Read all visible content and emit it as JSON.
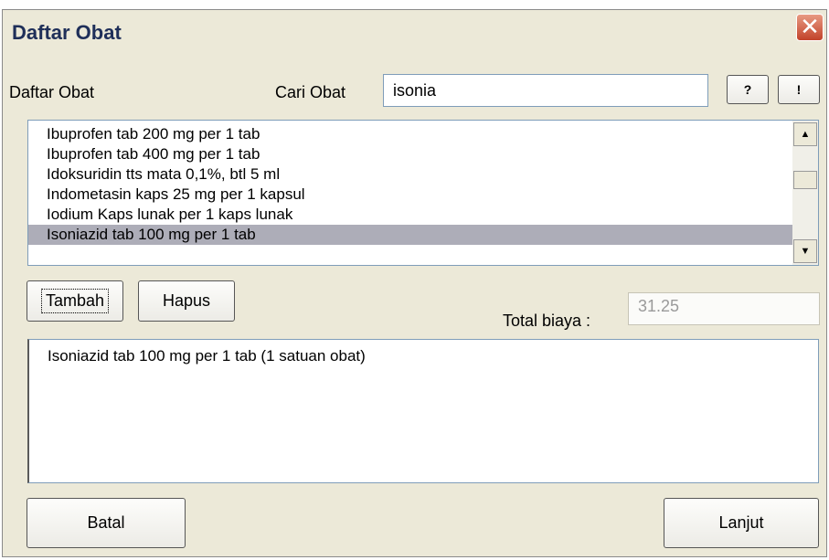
{
  "window": {
    "title": "Daftar Obat",
    "close_glyph": "✕"
  },
  "labels": {
    "list_label": "Daftar Obat",
    "search_label": "Cari Obat",
    "total_label": "Total biaya :"
  },
  "search": {
    "value": "isonia",
    "help_label": "?",
    "exec_label": "!"
  },
  "list": {
    "items": [
      "Ibuprofen tab 200 mg per 1 tab",
      "Ibuprofen tab 400 mg per 1 tab",
      "Idoksuridin tts mata 0,1%, btl 5 ml",
      "Indometasin kaps 25 mg per 1 kapsul",
      "Iodium Kaps lunak per 1 kaps lunak",
      "Isoniazid tab 100 mg per 1 tab"
    ],
    "selected_index": 5
  },
  "buttons": {
    "add": "Tambah",
    "remove": "Hapus",
    "cancel": "Batal",
    "next": "Lanjut"
  },
  "total": {
    "value": "31.25"
  },
  "selected_items": [
    "Isoniazid tab 100 mg per 1 tab (1 satuan obat)"
  ],
  "icons": {
    "close": "close-icon",
    "scroll_up": "scroll-up-icon",
    "scroll_down": "scroll-down-icon"
  }
}
